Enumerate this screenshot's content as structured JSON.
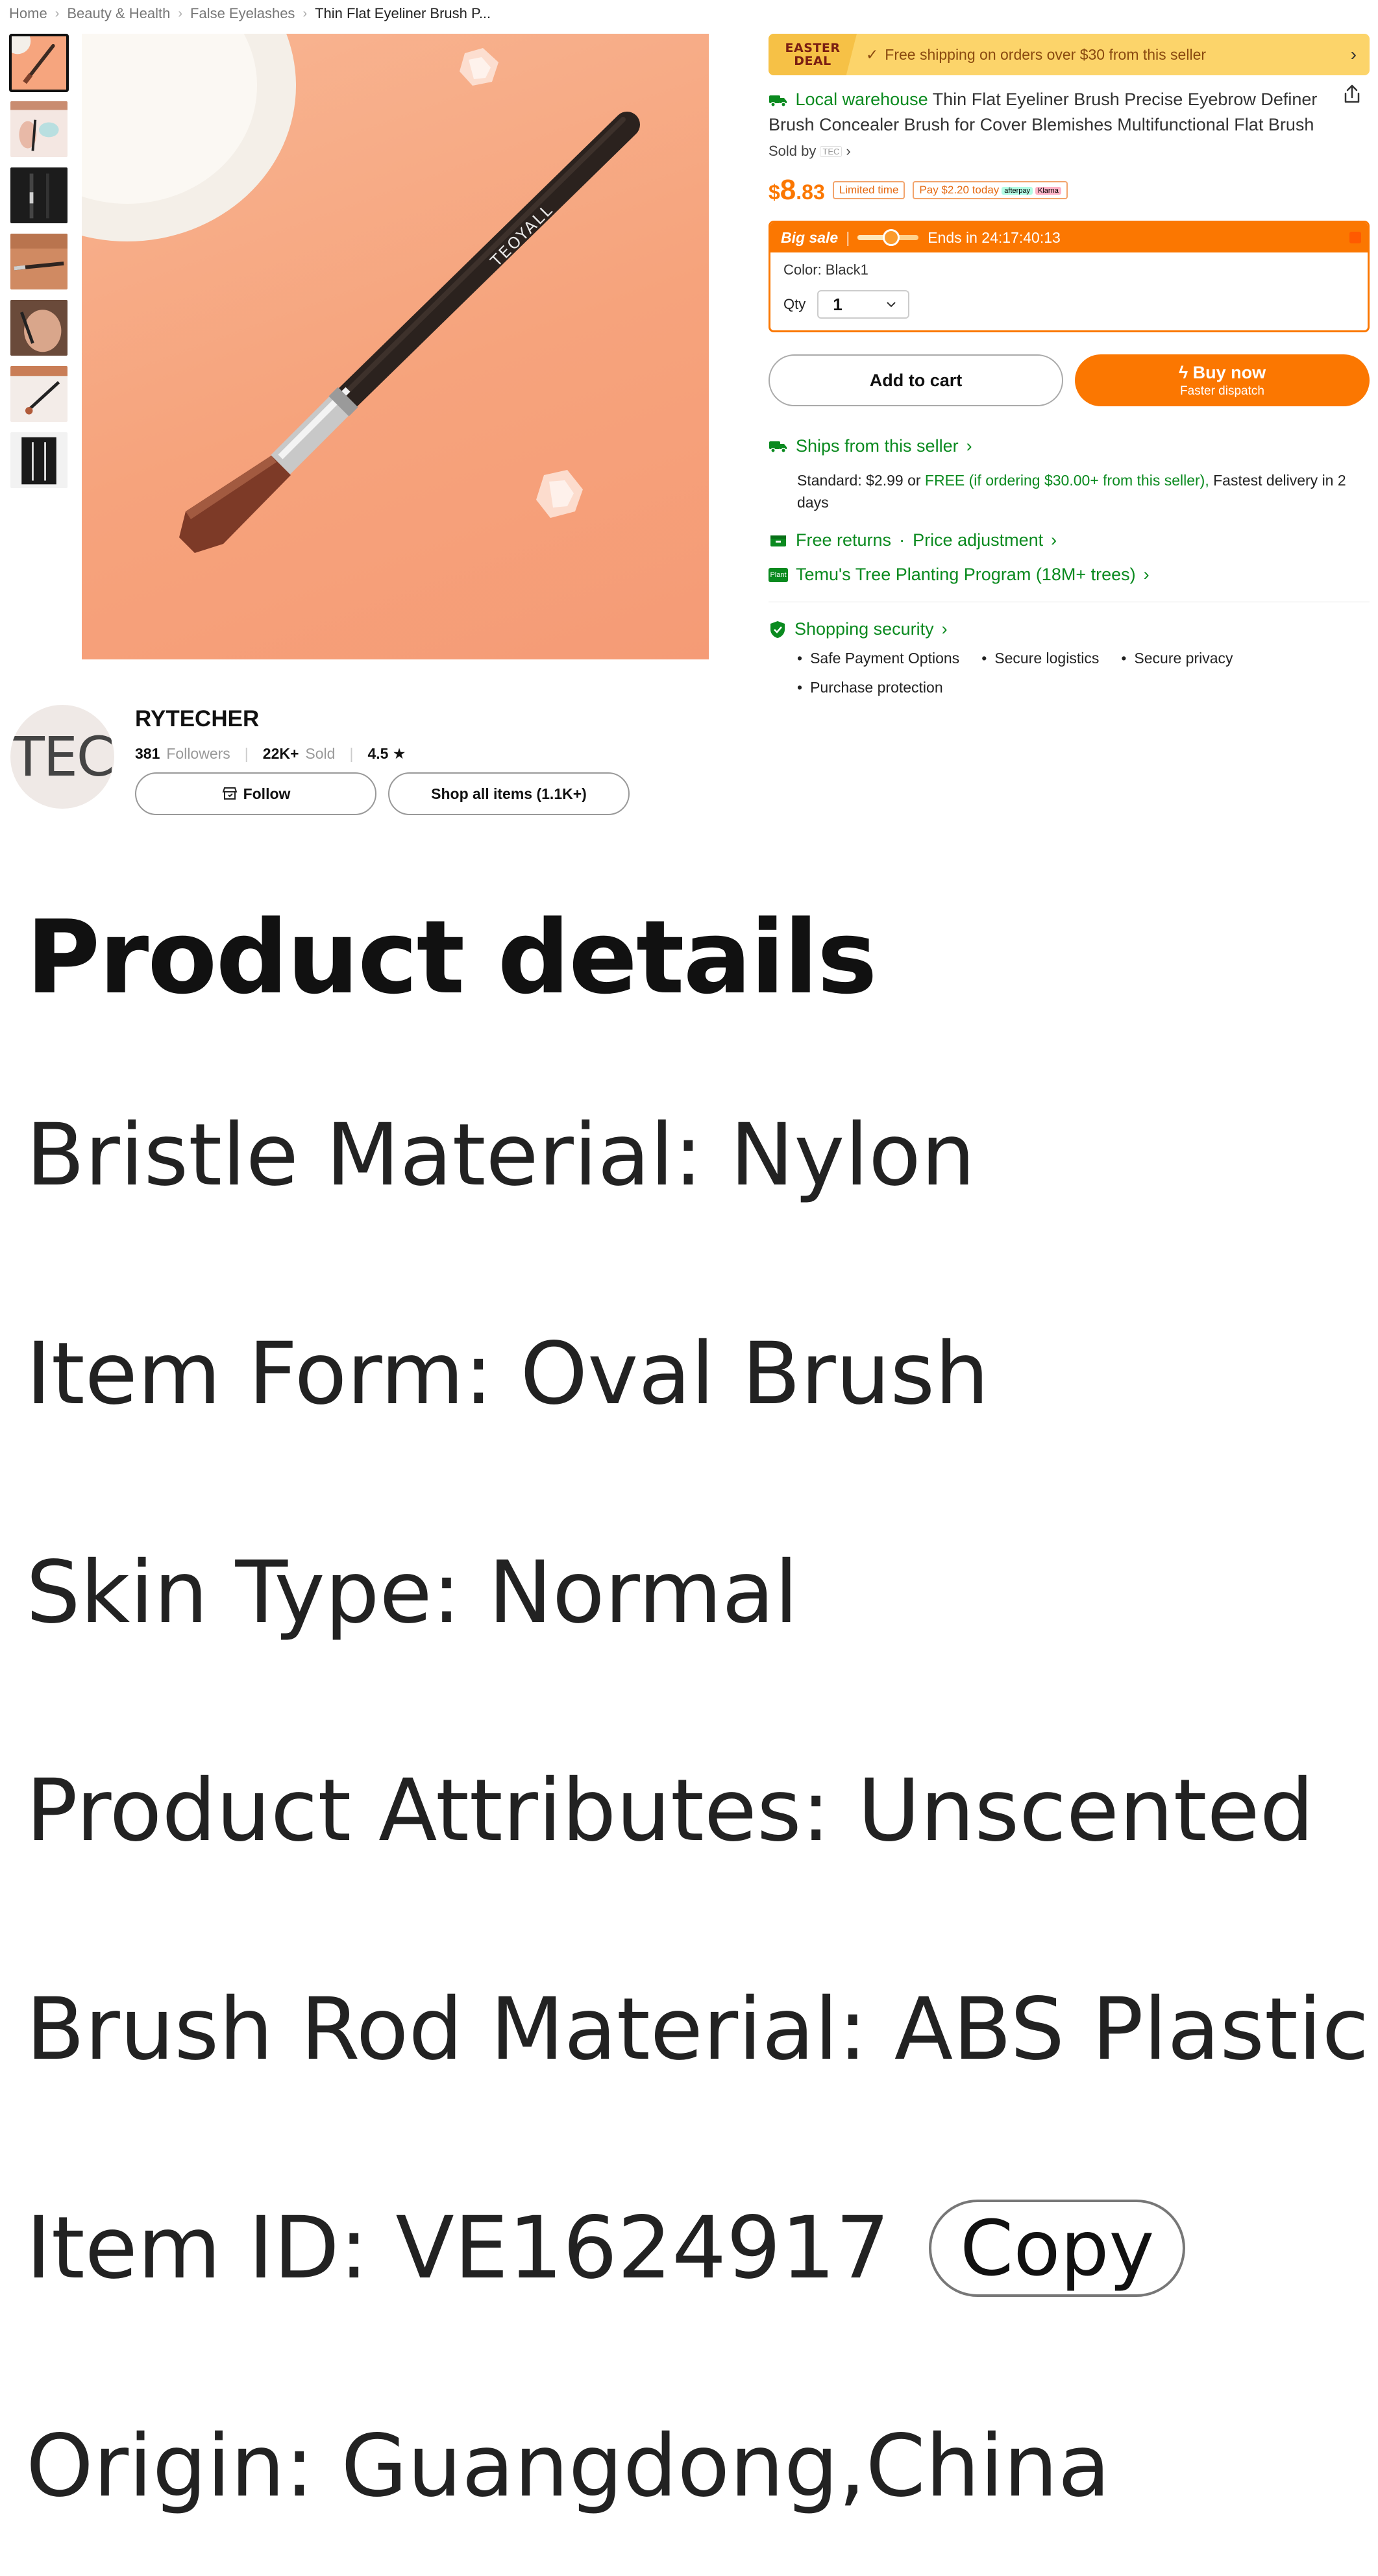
{
  "breadcrumb": {
    "items": [
      "Home",
      "Beauty & Health",
      "False Eyelashes"
    ],
    "current": "Thin Flat Eyeliner Brush P..."
  },
  "gallery": {
    "thumb_count": 7,
    "active_index": 0,
    "brush_brand_text": "TEOYALL"
  },
  "promo": {
    "badge_line1": "EASTER",
    "badge_line2": "DEAL",
    "text": "Free shipping on orders over $30 from this seller"
  },
  "product": {
    "warehouse_label": "Local warehouse",
    "title": "Thin Flat Eyeliner Brush Precise Eyebrow Definer Brush Concealer Brush for Cover Blemishes Multifunctional Flat Brush",
    "sold_by_label": "Sold by",
    "seller_logo_text": "TEC"
  },
  "price": {
    "currency": "$",
    "whole": "8",
    "cents": ".83",
    "limited_time": "Limited time",
    "pay_today": "Pay $2.20 today",
    "afterpay": "afterpay",
    "klarna": "Klarna"
  },
  "sale": {
    "label": "Big sale",
    "progress": 0.55,
    "ends_in": "Ends in 24:17:40:13",
    "color_line": "Color: Black1",
    "qty_label": "Qty",
    "qty_value": "1"
  },
  "buttons": {
    "add_to_cart": "Add to cart",
    "buy_now": "Buy now",
    "buy_now_sub": "Faster dispatch"
  },
  "shipping": {
    "title": "Ships from this seller",
    "standard_prefix": "Standard: $2.99 or ",
    "standard_free": "FREE (if ordering $30.00+ from this seller),",
    "standard_suffix": " Fastest delivery in 2 days"
  },
  "returns": {
    "free_returns": "Free returns",
    "price_adjustment": "Price adjustment"
  },
  "tree": {
    "tag": "Plant",
    "text": "Temu's Tree Planting Program (18M+ trees)"
  },
  "security": {
    "title": "Shopping security",
    "items": [
      "Safe Payment Options",
      "Secure logistics",
      "Secure privacy",
      "Purchase protection"
    ]
  },
  "store": {
    "avatar_text": "TEC",
    "name": "RYTECHER",
    "followers_value": "381",
    "followers_label": "Followers",
    "sold_value": "22K+",
    "sold_label": "Sold",
    "rating": "4.5 ★",
    "follow": "Follow",
    "shop_all": "Shop all items (1.1K+)"
  },
  "details": {
    "heading": "Product details",
    "rows": [
      "Bristle Material: Nylon",
      "Item Form: Oval Brush",
      "Skin Type: Normal",
      "Product Attributes: Unscented",
      "Brush Rod Material: ABS Plastic",
      "Item ID: VE1624917",
      "Origin: Guangdong,China"
    ],
    "copy": "Copy"
  },
  "colors": {
    "accent_orange": "#fb7701",
    "green": "#0a8a1f",
    "promo_yellow": "#fcd46a"
  }
}
